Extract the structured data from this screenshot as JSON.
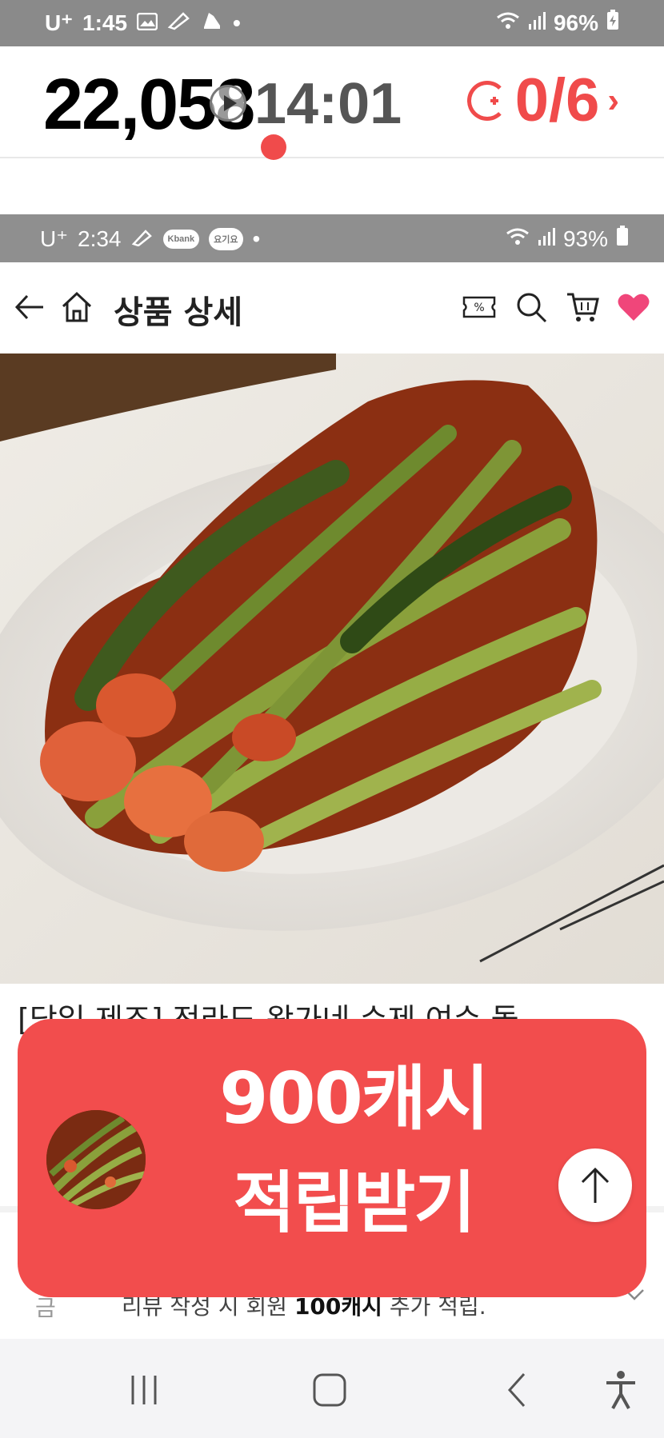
{
  "outer_status_bar": {
    "carrier": "U⁺",
    "time": "1:45",
    "notification_icons": [
      "gallery-icon",
      "pen-icon",
      "sneaker-icon"
    ],
    "dot": "•",
    "battery": "96%"
  },
  "overlay": {
    "counter": "22,058",
    "timer": "14:01",
    "cash_progress": "0/6",
    "cash_symbol": "C+",
    "chevron": "›"
  },
  "inner_status_bar": {
    "carrier": "U⁺",
    "time": "2:34",
    "pill1": "Kbank",
    "pill2": "요기요",
    "dot": "•",
    "battery": "93%"
  },
  "header": {
    "title": "상품 상세",
    "icons": [
      "back-arrow-icon",
      "home-icon",
      "coupon-icon",
      "search-icon",
      "cart-icon",
      "heart-icon"
    ],
    "coupon_label": "%"
  },
  "product": {
    "image_alt": "kimchi dish",
    "title_partial": "[당일 제조] 전라도 왕가네 수제 여수 돌"
  },
  "info": {
    "label": "금",
    "text_prefix": "리뷰 작성 시 회원",
    "text_bold": "100캐시",
    "text_suffix": "추가 적립."
  },
  "promo": {
    "line1": "900캐시",
    "line2": "적립받기"
  },
  "nav": {
    "items": [
      "recent-apps",
      "home",
      "back",
      "accessibility"
    ]
  },
  "colors": {
    "accent": "#f24d4d",
    "status_bar": "#8a8a8a"
  }
}
